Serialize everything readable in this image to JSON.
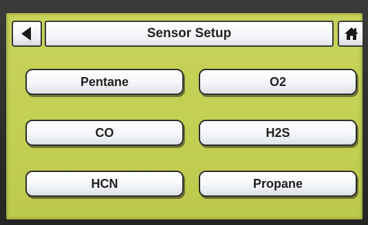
{
  "header": {
    "title": "Sensor Setup",
    "back_icon": "back-arrow-icon",
    "home_icon": "home-icon"
  },
  "sensors": {
    "items": [
      {
        "label": "Pentane"
      },
      {
        "label": "O2"
      },
      {
        "label": "CO"
      },
      {
        "label": "H2S"
      },
      {
        "label": "HCN"
      },
      {
        "label": "Propane"
      }
    ]
  },
  "colors": {
    "screen_background": "#c4d055",
    "button_face": "#f4f6f9",
    "button_border": "#2c2c2c"
  }
}
